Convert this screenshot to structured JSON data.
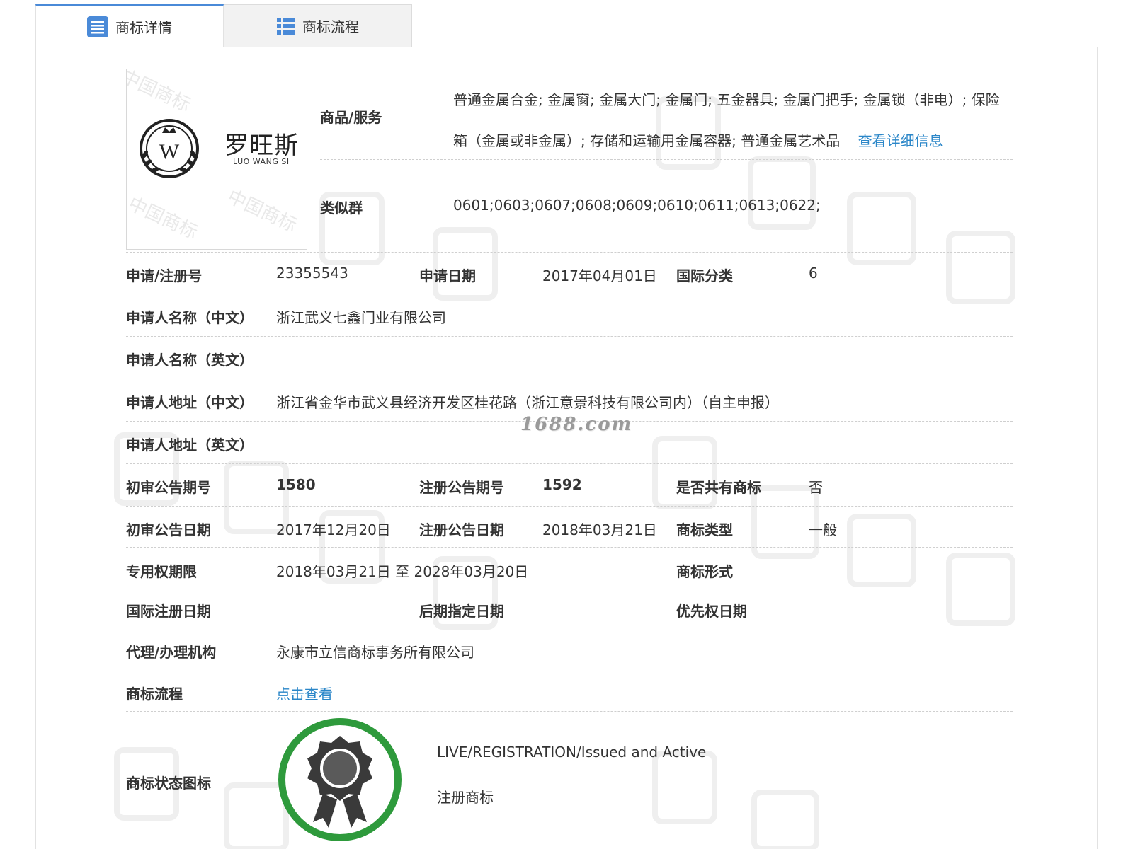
{
  "tabs": [
    {
      "label": "商标详情",
      "icon": "document-list-icon",
      "active": true
    },
    {
      "label": "商标流程",
      "icon": "list-view-icon",
      "active": false
    }
  ],
  "logo": {
    "chinese_name": "罗旺斯",
    "english_name": "LUO WANG SI",
    "emblem_letter": "W",
    "watermark_text": "中国商标"
  },
  "goods": {
    "label": "商品/服务",
    "text": "普通金属合金; 金属窗; 金属大门; 金属门; 五金器具; 金属门把手; 金属锁（非电）; 保险箱（金属或非金属）; 存储和运输用金属容器; 普通金属艺术品",
    "detail_link": "查看详细信息"
  },
  "similar_group": {
    "label": "类似群",
    "value": "0601;0603;0607;0608;0609;0610;0611;0613;0622;"
  },
  "rows": {
    "reg_no_label": "申请/注册号",
    "reg_no": "23355543",
    "apply_date_label": "申请日期",
    "apply_date": "2017年04月01日",
    "intl_class_label": "国际分类",
    "intl_class": "6",
    "applicant_cn_label": "申请人名称（中文）",
    "applicant_cn": "浙江武义七鑫门业有限公司",
    "applicant_en_label": "申请人名称（英文）",
    "applicant_en": "",
    "address_cn_label": "申请人地址（中文）",
    "address_cn": "浙江省金华市武义县经济开发区桂花路（浙江意景科技有限公司内）（自主申报）",
    "address_en_label": "申请人地址（英文）",
    "address_en": "",
    "prelim_no_label": "初审公告期号",
    "prelim_no": "1580",
    "reg_pub_no_label": "注册公告期号",
    "reg_pub_no": "1592",
    "shared_label": "是否共有商标",
    "shared": "否",
    "prelim_date_label": "初审公告日期",
    "prelim_date": "2017年12月20日",
    "reg_pub_date_label": "注册公告日期",
    "reg_pub_date": "2018年03月21日",
    "tm_type_label": "商标类型",
    "tm_type": "一般",
    "exclusive_label": "专用权期限",
    "exclusive": "2018年03月21日 至 2028年03月20日",
    "tm_form_label": "商标形式",
    "tm_form": "",
    "intl_reg_date_label": "国际注册日期",
    "intl_reg_date": "",
    "later_date_label": "后期指定日期",
    "later_date": "",
    "priority_date_label": "优先权日期",
    "priority_date": "",
    "agency_label": "代理/办理机构",
    "agency": "永康市立信商标事务所有限公司",
    "flow_label": "商标流程",
    "flow_link": "点击查看",
    "status_label": "商标状态图标",
    "status_en": "LIVE/REGISTRATION/Issued and Active",
    "status_cn": "注册商标"
  },
  "watermark_site": "1688.com",
  "colors": {
    "link": "#2a86c8",
    "tab_accent": "#4a8ad8",
    "badge_green": "#2e9a3c"
  }
}
